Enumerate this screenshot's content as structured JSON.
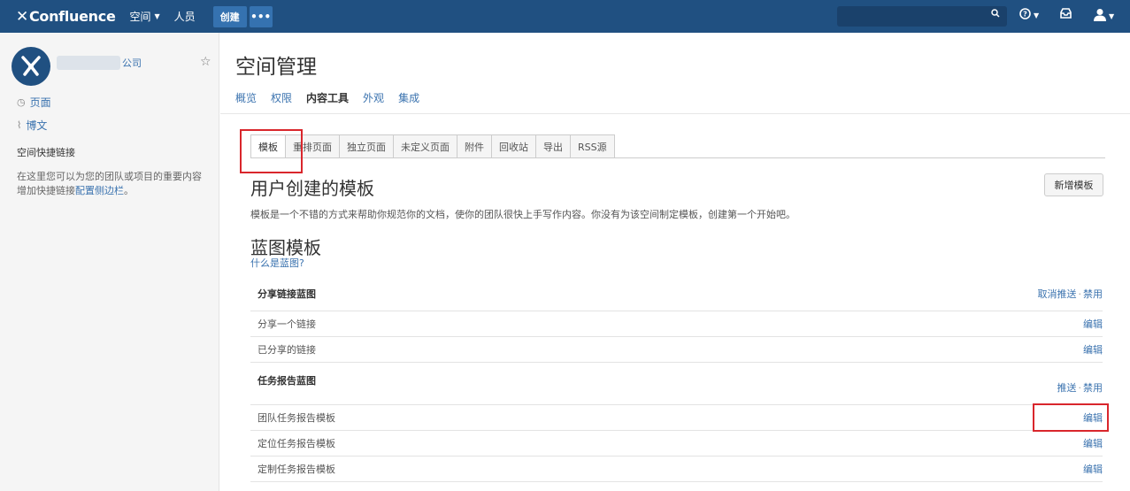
{
  "topnav": {
    "brand": "Confluence",
    "spaces_label": "空间",
    "people_label": "人员",
    "create_label": "创建",
    "more_label": "•••"
  },
  "sidebar": {
    "space_name_suffix": "公司",
    "links": [
      {
        "icon": "page-icon",
        "label": "页面"
      },
      {
        "icon": "blog-icon",
        "label": "博文"
      }
    ],
    "shortcuts_heading": "空间快捷链接",
    "shortcuts_desc": "在这里您可以为您的团队或项目的重要内容增加快捷链接",
    "shortcuts_link": "配置侧边栏",
    "shortcuts_end": "。"
  },
  "page": {
    "title": "空间管理",
    "subnav": [
      "概览",
      "权限",
      "内容工具",
      "外观",
      "集成"
    ],
    "active_subnav": "内容工具"
  },
  "tabs": [
    "模板",
    "重排页面",
    "独立页面",
    "未定义页面",
    "附件",
    "回收站",
    "导出",
    "RSS源"
  ],
  "user_templates": {
    "title": "用户创建的模板",
    "new_button": "新增模板",
    "description": "模板是一个不错的方式来帮助你规范你的文档，使你的团队很快上手写作内容。你没有为该空间制定模板，创建第一个开始吧。"
  },
  "blueprints": {
    "title": "蓝图模板",
    "what_link": "什么是蓝图?",
    "groups": [
      {
        "name": "分享链接蓝图",
        "actions": [
          "取消推送",
          "禁用"
        ],
        "items": [
          {
            "name": "分享一个链接",
            "action": "编辑"
          },
          {
            "name": "已分享的链接",
            "action": "编辑"
          }
        ]
      },
      {
        "name": "任务报告蓝图",
        "actions": [
          "推送",
          "禁用"
        ],
        "items": [
          {
            "name": "团队任务报告模板",
            "action": "编辑"
          },
          {
            "name": "定位任务报告模板",
            "action": "编辑"
          },
          {
            "name": "定制任务报告模板",
            "action": "编辑"
          }
        ]
      }
    ],
    "action_separator": "·"
  },
  "colors": {
    "header": "#205081",
    "link": "#3b73af",
    "highlight": "#d9262c"
  }
}
